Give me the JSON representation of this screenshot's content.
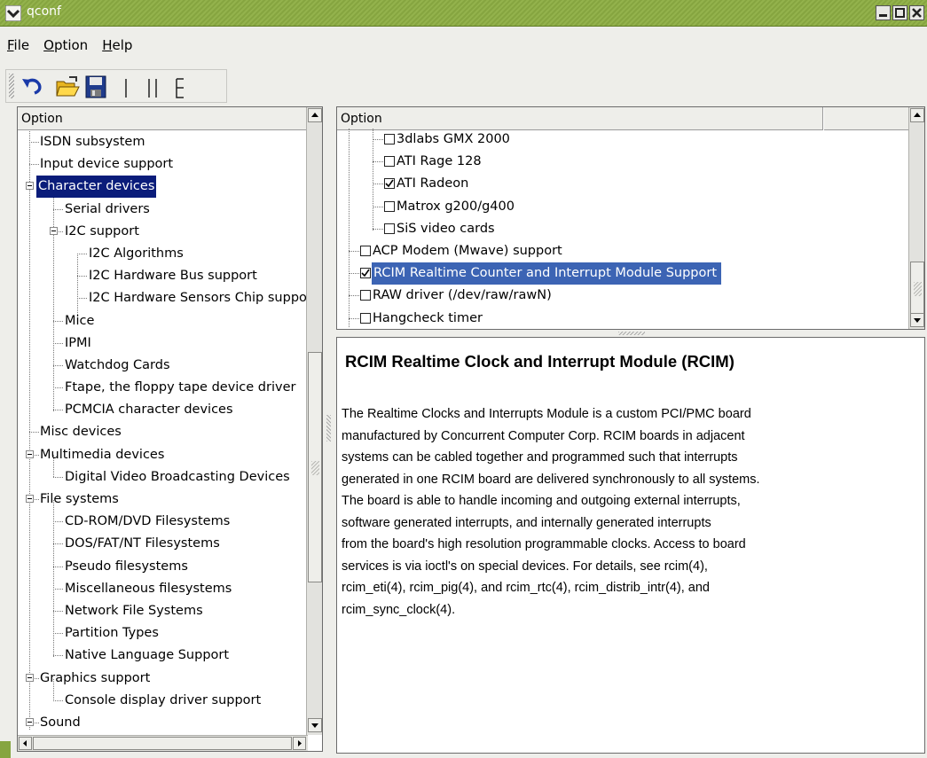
{
  "window": {
    "title": "qconf"
  },
  "menubar": {
    "items": [
      {
        "label_rest": "ile",
        "mnemonic": "F"
      },
      {
        "label_rest": "ption",
        "mnemonic": "O"
      },
      {
        "label_rest": "elp",
        "mnemonic": "H"
      }
    ]
  },
  "toolbar": {
    "icons": [
      "undo-icon",
      "open-folder-icon",
      "save-disk-icon",
      "single-view-icon",
      "split-view-icon",
      "full-view-icon"
    ]
  },
  "left_panel": {
    "header": "Option",
    "rows": [
      {
        "label": "ISDN subsystem"
      },
      {
        "label": "Input device support"
      },
      {
        "label": "Character devices"
      },
      {
        "label": "Serial drivers"
      },
      {
        "label": "I2C support"
      },
      {
        "label": "I2C Algorithms"
      },
      {
        "label": "I2C Hardware Bus support"
      },
      {
        "label": "I2C Hardware Sensors Chip support"
      },
      {
        "label": "Mice"
      },
      {
        "label": "IPMI"
      },
      {
        "label": "Watchdog Cards"
      },
      {
        "label": "Ftape, the floppy tape device driver"
      },
      {
        "label": "PCMCIA character devices"
      },
      {
        "label": "Misc devices"
      },
      {
        "label": "Multimedia devices"
      },
      {
        "label": "Digital Video Broadcasting Devices"
      },
      {
        "label": "File systems"
      },
      {
        "label": "CD-ROM/DVD Filesystems"
      },
      {
        "label": "DOS/FAT/NT Filesystems"
      },
      {
        "label": "Pseudo filesystems"
      },
      {
        "label": "Miscellaneous filesystems"
      },
      {
        "label": "Network File Systems"
      },
      {
        "label": "Partition Types"
      },
      {
        "label": "Native Language Support"
      },
      {
        "label": "Graphics support"
      },
      {
        "label": "Console display driver support"
      },
      {
        "label": "Sound"
      }
    ]
  },
  "right_panel": {
    "header": "Option",
    "rows": [
      {
        "label": "3dlabs GMX 2000",
        "checked": false
      },
      {
        "label": "ATI Rage 128",
        "checked": false
      },
      {
        "label": "ATI Radeon",
        "checked": true
      },
      {
        "label": "Matrox g200/g400",
        "checked": false
      },
      {
        "label": "SiS video cards",
        "checked": false
      },
      {
        "label": "ACP Modem (Mwave) support",
        "checked": false
      },
      {
        "label": "RCIM Realtime Counter and Interrupt Module Support",
        "checked": true
      },
      {
        "label": "RAW driver (/dev/raw/rawN)",
        "checked": false
      },
      {
        "label": "Hangcheck timer",
        "checked": false
      }
    ]
  },
  "help": {
    "title": "RCIM Realtime Clock and Interrupt Module (RCIM)",
    "body": "The Realtime Clocks and Interrupts Module is a custom PCI/PMC board\nmanufactured by Concurrent Computer Corp. RCIM boards in adjacent\nsystems can be cabled together and programmed such that interrupts\ngenerated in one RCIM board are delivered synchronously to all systems.\nThe board is able to handle incoming and outgoing external interrupts,\nsoftware generated interrupts, and internally generated interrupts\nfrom the board's high resolution programmable clocks. Access to board\nservices is via ioctl's on special devices. For details, see rcim(4),\nrcim_eti(4), rcim_pig(4), and rcim_rtc(4), rcim_distrib_intr(4), and\nrcim_sync_clock(4)."
  }
}
